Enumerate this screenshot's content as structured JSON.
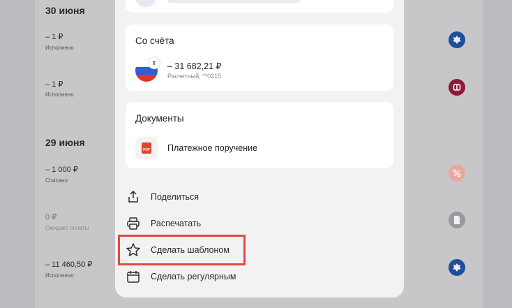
{
  "background_list": [
    {
      "date": "30 июня",
      "items": [
        {
          "amount": "– 1 ₽",
          "status": "Исполнено",
          "icon": "emblem-icon",
          "icon_color": "#1f4e9d"
        },
        {
          "amount": "– 1 ₽",
          "status": "Исполнено",
          "icon": "bank-logo-icon",
          "icon_color": "#8e1b3a"
        }
      ]
    },
    {
      "date": "29 июня",
      "items": [
        {
          "amount": "– 1 000 ₽",
          "status": "Списано",
          "icon": "percent-icon",
          "icon_color": "#e8a79c"
        },
        {
          "amount": "0 ₽",
          "status": "Ожидает оплаты",
          "icon": "document-icon",
          "icon_color": "#9a9a9e"
        },
        {
          "amount": "– 11 460,50 ₽",
          "status": "Исполнено",
          "icon": "emblem-icon",
          "icon_color": "#1f4e9d"
        }
      ]
    }
  ],
  "from_account": {
    "title": "Со счёта",
    "amount": "– 31 682,21 ₽",
    "account": "Расчетный, **0215"
  },
  "documents": {
    "title": "Документы",
    "file_label": "Платежное поручение",
    "file_badge": "PDF"
  },
  "actions": [
    {
      "label": "Поделиться",
      "icon": "share-icon"
    },
    {
      "label": "Распечатать",
      "icon": "printer-icon"
    },
    {
      "label": "Сделать шаблоном",
      "icon": "star-icon"
    },
    {
      "label": "Сделать регулярным",
      "icon": "calendar-icon"
    }
  ],
  "colors": {
    "highlight": "#e24a3b",
    "pdf": "#e8422f",
    "flag_blue": "#2f5fd1",
    "flag_red": "#e0352b"
  }
}
